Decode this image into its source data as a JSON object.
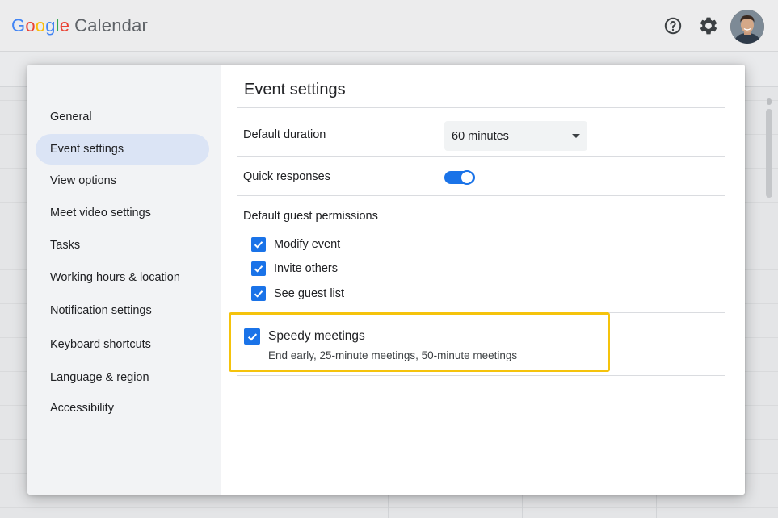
{
  "app": {
    "logo_letters": [
      "G",
      "o",
      "o",
      "g",
      "l",
      "e"
    ],
    "logo_product": "Calendar",
    "help_icon": "help-circle-icon",
    "settings_icon": "gear-icon",
    "avatar": "user-avatar"
  },
  "sidebar": {
    "items": [
      {
        "label": "General",
        "active": false
      },
      {
        "label": "Event settings",
        "active": true
      },
      {
        "label": "View options",
        "active": false
      },
      {
        "label": "Meet video settings",
        "active": false
      },
      {
        "label": "Tasks",
        "active": false
      },
      {
        "label": "Working hours & location",
        "active": false
      },
      {
        "label": "Notification settings",
        "active": false
      },
      {
        "label": "Keyboard shortcuts",
        "active": false
      },
      {
        "label": "Language & region",
        "active": false
      },
      {
        "label": "Accessibility",
        "active": false
      }
    ]
  },
  "event_settings": {
    "title": "Event settings",
    "default_duration": {
      "label": "Default duration",
      "value": "60 minutes"
    },
    "quick_responses": {
      "label": "Quick responses",
      "enabled": true
    },
    "guest_permissions": {
      "label": "Default guest permissions",
      "options": [
        {
          "label": "Modify event",
          "checked": true
        },
        {
          "label": "Invite others",
          "checked": true
        },
        {
          "label": "See guest list",
          "checked": true
        }
      ]
    },
    "speedy_meetings": {
      "label": "Speedy meetings",
      "description": "End early, 25-minute meetings, 50-minute meetings",
      "checked": true
    }
  },
  "colors": {
    "accent": "#1a73e8",
    "highlight": "#f5c30c",
    "active_nav": "#dbe4f5"
  }
}
